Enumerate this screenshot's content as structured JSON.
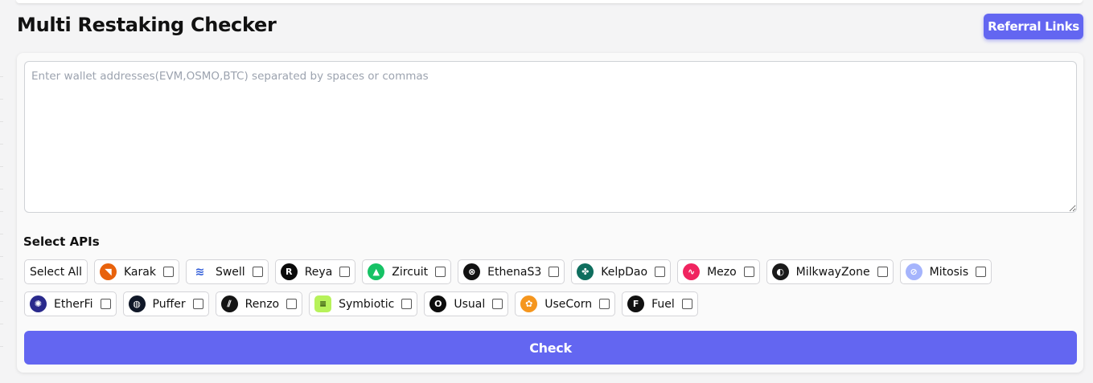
{
  "header": {
    "title": "Multi Restaking Checker",
    "referral_label": "Referral Links"
  },
  "wallet": {
    "placeholder": "Enter wallet addresses(EVM,OSMO,BTC) separated by spaces or commas",
    "value": ""
  },
  "apis": {
    "section_label": "Select APIs",
    "select_all_label": "Select All",
    "row1": [
      {
        "name": "Karak",
        "icon": "karak-icon",
        "color": "#e8620c",
        "glyph": "◥"
      },
      {
        "name": "Swell",
        "icon": "swell-icon",
        "color": "#ffffff",
        "glyph": "≋"
      },
      {
        "name": "Reya",
        "icon": "reya-icon",
        "color": "#0a0a0a",
        "glyph": "R"
      },
      {
        "name": "Zircuit",
        "icon": "zircuit-icon",
        "color": "#16c265",
        "glyph": "▲"
      },
      {
        "name": "EthenaS3",
        "icon": "ethena-icon",
        "color": "#111111",
        "glyph": "⊗"
      },
      {
        "name": "KelpDao",
        "icon": "kelpdao-icon",
        "color": "#0f6e5e",
        "glyph": "✤"
      },
      {
        "name": "Mezo",
        "icon": "mezo-icon",
        "color": "#f0245f",
        "glyph": "∿"
      },
      {
        "name": "MilkwayZone",
        "icon": "milkway-icon",
        "color": "#1a1a1a",
        "glyph": "◐"
      },
      {
        "name": "Mitosis",
        "icon": "mitosis-icon",
        "color": "#a5b4fc",
        "glyph": "⊘"
      }
    ],
    "row2": [
      {
        "name": "EtherFi",
        "icon": "etherfi-icon",
        "color": "#2a2a8c",
        "glyph": "✺"
      },
      {
        "name": "Puffer",
        "icon": "puffer-icon",
        "color": "#101828",
        "glyph": "◍"
      },
      {
        "name": "Renzo",
        "icon": "renzo-icon",
        "color": "#141414",
        "glyph": "⫽"
      },
      {
        "name": "Symbiotic",
        "icon": "symbiotic-icon",
        "color": "#b7f25a",
        "glyph": "≡"
      },
      {
        "name": "Usual",
        "icon": "usual-icon",
        "color": "#0d0d0d",
        "glyph": "O"
      },
      {
        "name": "UseCorn",
        "icon": "usecorn-icon",
        "color": "#f5961e",
        "glyph": "✿"
      },
      {
        "name": "Fuel",
        "icon": "fuel-icon",
        "color": "#111111",
        "glyph": "F"
      }
    ]
  },
  "actions": {
    "check_label": "Check"
  },
  "colors": {
    "accent": "#6366f1",
    "background": "#f4f4f5",
    "card": "#fafafa"
  }
}
